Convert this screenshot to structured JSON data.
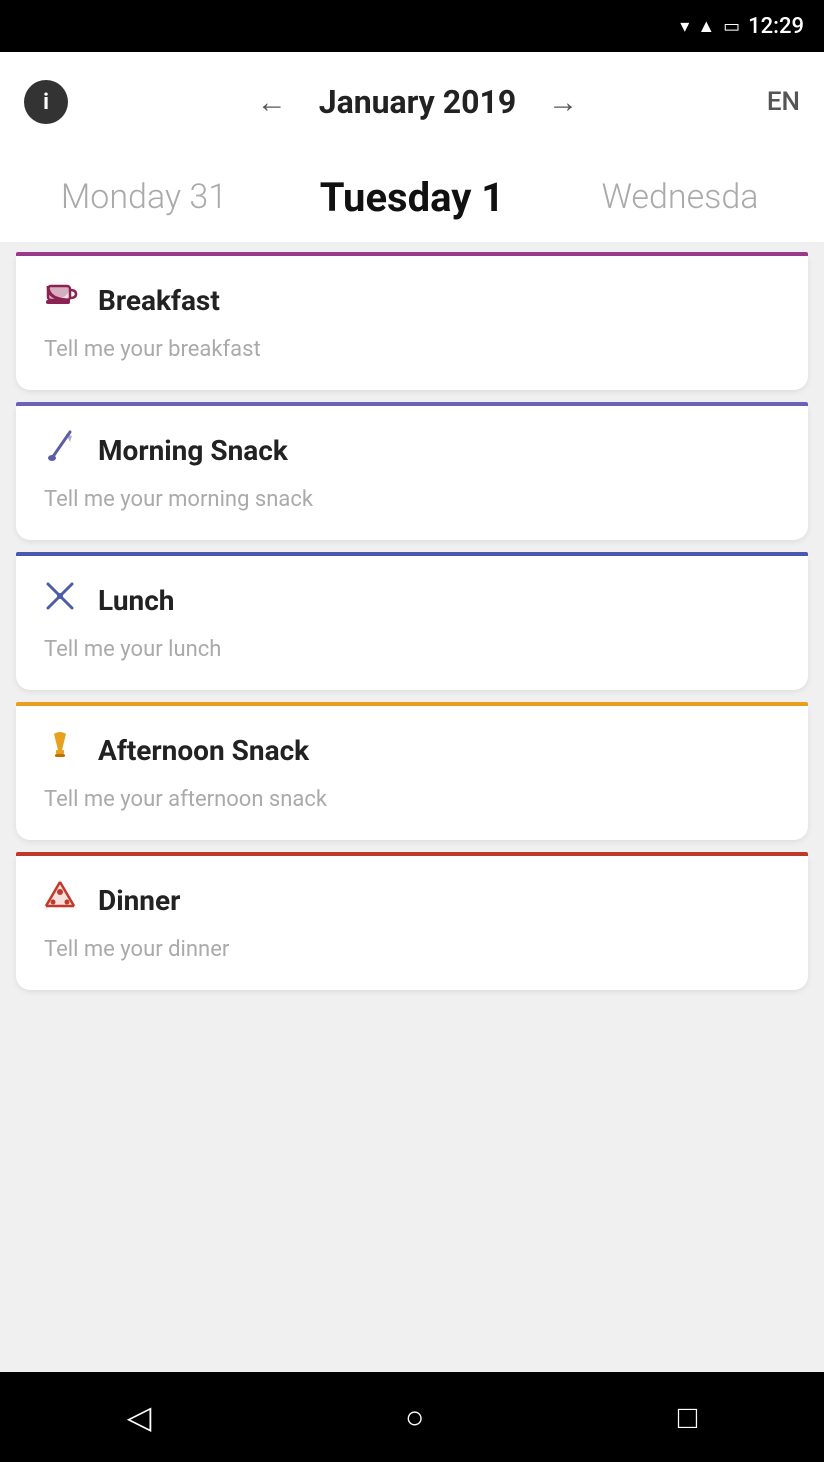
{
  "statusBar": {
    "time": "12:29"
  },
  "header": {
    "infoLabel": "i",
    "prevArrow": "←",
    "title": "January 2019",
    "nextArrow": "→",
    "lang": "EN"
  },
  "daySelector": {
    "prev": "Monday 31",
    "current": "Tuesday 1",
    "next": "Wednesda"
  },
  "meals": [
    {
      "id": "breakfast",
      "topLineColor": "#9B3A8A",
      "icon": "☕",
      "iconClass": "icon-breakfast",
      "title": "Breakfast",
      "placeholder": "Tell me your breakfast"
    },
    {
      "id": "morning-snack",
      "topLineColor": "#6B62B8",
      "icon": "✏️",
      "iconClass": "icon-morning-snack",
      "title": "Morning Snack",
      "placeholder": "Tell me your morning snack"
    },
    {
      "id": "lunch",
      "topLineColor": "#4A58B0",
      "icon": "✂",
      "iconClass": "icon-lunch",
      "title": "Lunch",
      "placeholder": "Tell me your lunch"
    },
    {
      "id": "afternoon-snack",
      "topLineColor": "#E8A020",
      "icon": "🍦",
      "iconClass": "icon-afternoon-snack",
      "title": "Afternoon Snack",
      "placeholder": "Tell me your afternoon snack"
    },
    {
      "id": "dinner",
      "topLineColor": "#C0392B",
      "icon": "🍕",
      "iconClass": "icon-dinner",
      "title": "Dinner",
      "placeholder": "Tell me your dinner"
    }
  ],
  "bottomNav": {
    "back": "◁",
    "home": "○",
    "recent": "□"
  }
}
